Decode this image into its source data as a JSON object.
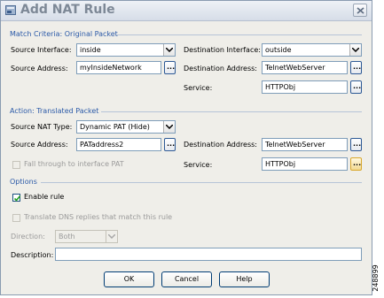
{
  "window": {
    "title": "Add NAT Rule",
    "icon": "nat-rule-icon",
    "close_icon": "close-icon"
  },
  "match_criteria": {
    "heading": "Match Criteria: Original Packet",
    "source_interface": {
      "label": "Source Interface:",
      "value": "inside"
    },
    "destination_interface": {
      "label": "Destination Interface:",
      "value": "outside"
    },
    "source_address": {
      "label": "Source Address:",
      "value": "myInsideNetwork"
    },
    "destination_address": {
      "label": "Destination Address:",
      "value": "TelnetWebServer"
    },
    "service": {
      "label": "Service:",
      "value": "HTTPObj"
    }
  },
  "action": {
    "heading": "Action: Translated Packet",
    "source_nat_type": {
      "label": "Source NAT Type:",
      "value": "Dynamic PAT (Hide)"
    },
    "source_address": {
      "label": "Source Address:",
      "value": "PATaddress2"
    },
    "destination_address": {
      "label": "Destination Address:",
      "value": "TelnetWebServer"
    },
    "fall_through": {
      "label": "Fall through to interface PAT",
      "checked": false,
      "disabled": true
    },
    "service": {
      "label": "Service:",
      "value": "HTTPObj"
    }
  },
  "options": {
    "heading": "Options",
    "enable_rule": {
      "label": "Enable rule",
      "checked": true
    },
    "translate_dns": {
      "label": "Translate DNS replies that match this rule",
      "checked": false,
      "disabled": true
    },
    "direction": {
      "label": "Direction:",
      "value": "Both",
      "disabled": true
    },
    "description": {
      "label": "Description:",
      "value": ""
    }
  },
  "buttons": {
    "ok": "OK",
    "cancel": "Cancel",
    "help": "Help"
  },
  "ellipsis": "...",
  "figure_code": "248899",
  "colors": {
    "section_heading": "#2b5aa8",
    "field_border": "#7f9db9",
    "window_bg": "#efeee9"
  }
}
